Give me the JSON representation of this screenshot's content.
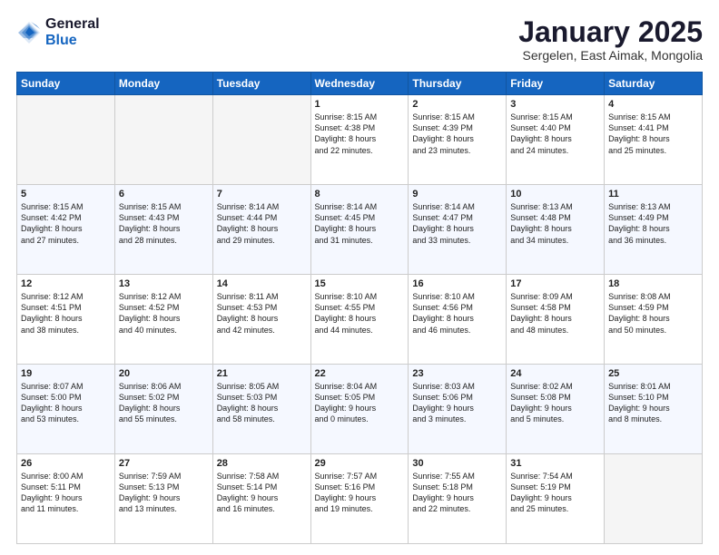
{
  "header": {
    "logo_general": "General",
    "logo_blue": "Blue",
    "month_title": "January 2025",
    "subtitle": "Sergelen, East Aimak, Mongolia"
  },
  "days_of_week": [
    "Sunday",
    "Monday",
    "Tuesday",
    "Wednesday",
    "Thursday",
    "Friday",
    "Saturday"
  ],
  "weeks": [
    {
      "days": [
        {
          "num": "",
          "info": ""
        },
        {
          "num": "",
          "info": ""
        },
        {
          "num": "",
          "info": ""
        },
        {
          "num": "1",
          "info": "Sunrise: 8:15 AM\nSunset: 4:38 PM\nDaylight: 8 hours\nand 22 minutes."
        },
        {
          "num": "2",
          "info": "Sunrise: 8:15 AM\nSunset: 4:39 PM\nDaylight: 8 hours\nand 23 minutes."
        },
        {
          "num": "3",
          "info": "Sunrise: 8:15 AM\nSunset: 4:40 PM\nDaylight: 8 hours\nand 24 minutes."
        },
        {
          "num": "4",
          "info": "Sunrise: 8:15 AM\nSunset: 4:41 PM\nDaylight: 8 hours\nand 25 minutes."
        }
      ]
    },
    {
      "days": [
        {
          "num": "5",
          "info": "Sunrise: 8:15 AM\nSunset: 4:42 PM\nDaylight: 8 hours\nand 27 minutes."
        },
        {
          "num": "6",
          "info": "Sunrise: 8:15 AM\nSunset: 4:43 PM\nDaylight: 8 hours\nand 28 minutes."
        },
        {
          "num": "7",
          "info": "Sunrise: 8:14 AM\nSunset: 4:44 PM\nDaylight: 8 hours\nand 29 minutes."
        },
        {
          "num": "8",
          "info": "Sunrise: 8:14 AM\nSunset: 4:45 PM\nDaylight: 8 hours\nand 31 minutes."
        },
        {
          "num": "9",
          "info": "Sunrise: 8:14 AM\nSunset: 4:47 PM\nDaylight: 8 hours\nand 33 minutes."
        },
        {
          "num": "10",
          "info": "Sunrise: 8:13 AM\nSunset: 4:48 PM\nDaylight: 8 hours\nand 34 minutes."
        },
        {
          "num": "11",
          "info": "Sunrise: 8:13 AM\nSunset: 4:49 PM\nDaylight: 8 hours\nand 36 minutes."
        }
      ]
    },
    {
      "days": [
        {
          "num": "12",
          "info": "Sunrise: 8:12 AM\nSunset: 4:51 PM\nDaylight: 8 hours\nand 38 minutes."
        },
        {
          "num": "13",
          "info": "Sunrise: 8:12 AM\nSunset: 4:52 PM\nDaylight: 8 hours\nand 40 minutes."
        },
        {
          "num": "14",
          "info": "Sunrise: 8:11 AM\nSunset: 4:53 PM\nDaylight: 8 hours\nand 42 minutes."
        },
        {
          "num": "15",
          "info": "Sunrise: 8:10 AM\nSunset: 4:55 PM\nDaylight: 8 hours\nand 44 minutes."
        },
        {
          "num": "16",
          "info": "Sunrise: 8:10 AM\nSunset: 4:56 PM\nDaylight: 8 hours\nand 46 minutes."
        },
        {
          "num": "17",
          "info": "Sunrise: 8:09 AM\nSunset: 4:58 PM\nDaylight: 8 hours\nand 48 minutes."
        },
        {
          "num": "18",
          "info": "Sunrise: 8:08 AM\nSunset: 4:59 PM\nDaylight: 8 hours\nand 50 minutes."
        }
      ]
    },
    {
      "days": [
        {
          "num": "19",
          "info": "Sunrise: 8:07 AM\nSunset: 5:00 PM\nDaylight: 8 hours\nand 53 minutes."
        },
        {
          "num": "20",
          "info": "Sunrise: 8:06 AM\nSunset: 5:02 PM\nDaylight: 8 hours\nand 55 minutes."
        },
        {
          "num": "21",
          "info": "Sunrise: 8:05 AM\nSunset: 5:03 PM\nDaylight: 8 hours\nand 58 minutes."
        },
        {
          "num": "22",
          "info": "Sunrise: 8:04 AM\nSunset: 5:05 PM\nDaylight: 9 hours\nand 0 minutes."
        },
        {
          "num": "23",
          "info": "Sunrise: 8:03 AM\nSunset: 5:06 PM\nDaylight: 9 hours\nand 3 minutes."
        },
        {
          "num": "24",
          "info": "Sunrise: 8:02 AM\nSunset: 5:08 PM\nDaylight: 9 hours\nand 5 minutes."
        },
        {
          "num": "25",
          "info": "Sunrise: 8:01 AM\nSunset: 5:10 PM\nDaylight: 9 hours\nand 8 minutes."
        }
      ]
    },
    {
      "days": [
        {
          "num": "26",
          "info": "Sunrise: 8:00 AM\nSunset: 5:11 PM\nDaylight: 9 hours\nand 11 minutes."
        },
        {
          "num": "27",
          "info": "Sunrise: 7:59 AM\nSunset: 5:13 PM\nDaylight: 9 hours\nand 13 minutes."
        },
        {
          "num": "28",
          "info": "Sunrise: 7:58 AM\nSunset: 5:14 PM\nDaylight: 9 hours\nand 16 minutes."
        },
        {
          "num": "29",
          "info": "Sunrise: 7:57 AM\nSunset: 5:16 PM\nDaylight: 9 hours\nand 19 minutes."
        },
        {
          "num": "30",
          "info": "Sunrise: 7:55 AM\nSunset: 5:18 PM\nDaylight: 9 hours\nand 22 minutes."
        },
        {
          "num": "31",
          "info": "Sunrise: 7:54 AM\nSunset: 5:19 PM\nDaylight: 9 hours\nand 25 minutes."
        },
        {
          "num": "",
          "info": ""
        }
      ]
    }
  ]
}
